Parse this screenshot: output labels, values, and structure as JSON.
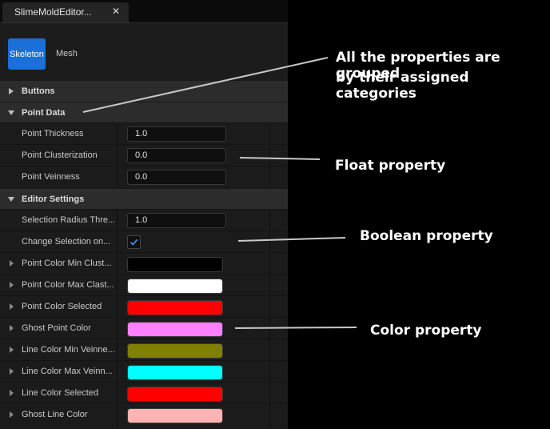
{
  "tab": {
    "title": "SlimeMoldEditor...",
    "close_glyph": "✕"
  },
  "toolbar": {
    "skeleton_label": "Skeleton",
    "mesh_label": "Mesh"
  },
  "categories": {
    "buttons": "Buttons",
    "point_data": "Point Data",
    "editor_settings": "Editor Settings"
  },
  "point_data": [
    {
      "label": "Point Thickness",
      "value": "1.0"
    },
    {
      "label": "Point Clusterization",
      "value": "0.0"
    },
    {
      "label": "Point Veinness",
      "value": "0.0"
    }
  ],
  "editor_settings": {
    "selection_radius": {
      "label": "Selection Radius Thre...",
      "value": "1.0"
    },
    "change_selection": {
      "label": "Change Selection on...",
      "checked": true
    },
    "colors": [
      {
        "label": "Point Color Min Clust...",
        "color": "#000000"
      },
      {
        "label": "Point Color Max Clast...",
        "color": "#ffffff"
      },
      {
        "label": "Point Color Selected",
        "color": "#ff0000"
      },
      {
        "label": "Ghost Point Color",
        "color": "#ff80ff"
      },
      {
        "label": "Line Color Min Veinne...",
        "color": "#808000"
      },
      {
        "label": "Line Color Max Veinn...",
        "color": "#00ffff"
      },
      {
        "label": "Line Color Selected",
        "color": "#ff0000"
      },
      {
        "label": "Ghost Line Color",
        "color": "#ffb3b3"
      }
    ]
  },
  "annotations": {
    "categories_line1": "All the properties are grouped",
    "categories_line2": "by their assigned categories",
    "float": "Float property",
    "boolean": "Boolean property",
    "color": "Color property"
  }
}
